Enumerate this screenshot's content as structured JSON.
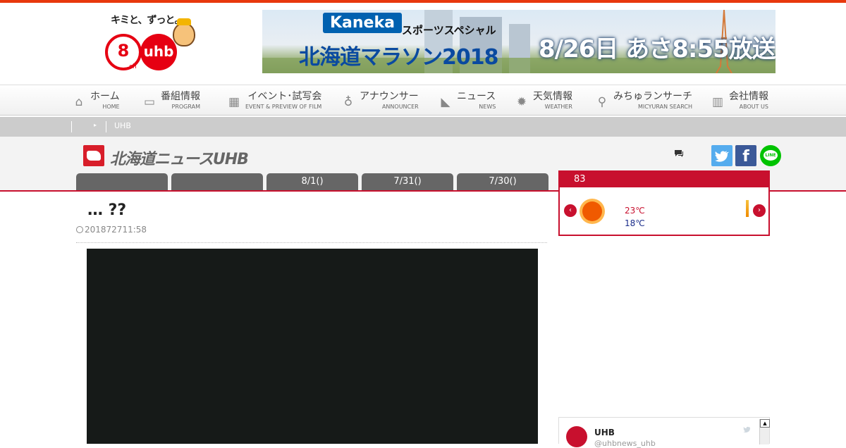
{
  "header": {
    "tagline": "キミと、ずっと。",
    "channel_number": "8",
    "channel_ch": "ch",
    "logo_text": "uhb",
    "banner": {
      "sponsor": "Kaneka",
      "sub": "スポーツスペシャル",
      "title": "北海道マラソン2018",
      "date": "8/26日 あさ8:55放送"
    }
  },
  "nav": [
    {
      "jp": "ホーム",
      "en": "HOME",
      "icon": "home-icon",
      "glyph": "⌂"
    },
    {
      "jp": "番組情報",
      "en": "PROGRAM",
      "icon": "tv-icon",
      "glyph": "▭"
    },
    {
      "jp": "イベント･試写会",
      "en": "EVENT & PREVIEW OF FILM",
      "icon": "calendar-icon",
      "glyph": "▦"
    },
    {
      "jp": "アナウンサー",
      "en": "ANNOUNCER",
      "icon": "microphone-icon",
      "glyph": "♁"
    },
    {
      "jp": "ニュース",
      "en": "NEWS",
      "icon": "megaphone-icon",
      "glyph": "◣"
    },
    {
      "jp": "天気情報",
      "en": "WEATHER",
      "icon": "sun-icon",
      "glyph": "✹"
    },
    {
      "jp": "みちゅランサーチ",
      "en": "MICYURAN SEARCH",
      "icon": "search-icon",
      "glyph": "⚲"
    },
    {
      "jp": "会社情報",
      "en": "ABOUT US",
      "icon": "building-icon",
      "glyph": "▥"
    }
  ],
  "breadcrumb": {
    "current": "UHB"
  },
  "news": {
    "title": "北海道ニュースUHB",
    "sns_fb": "f",
    "sns_line": "LINE"
  },
  "tabs": [
    "",
    "",
    "8/1()",
    "7/31()",
    "7/30()"
  ],
  "weather": {
    "header": "83",
    "prev": "‹",
    "next": "›",
    "high": "23℃",
    "low": "18℃"
  },
  "article": {
    "title": "… ??",
    "date": "201872711:58"
  },
  "twitter": {
    "name": "UHB",
    "handle": "@uhbnews_uhb"
  }
}
